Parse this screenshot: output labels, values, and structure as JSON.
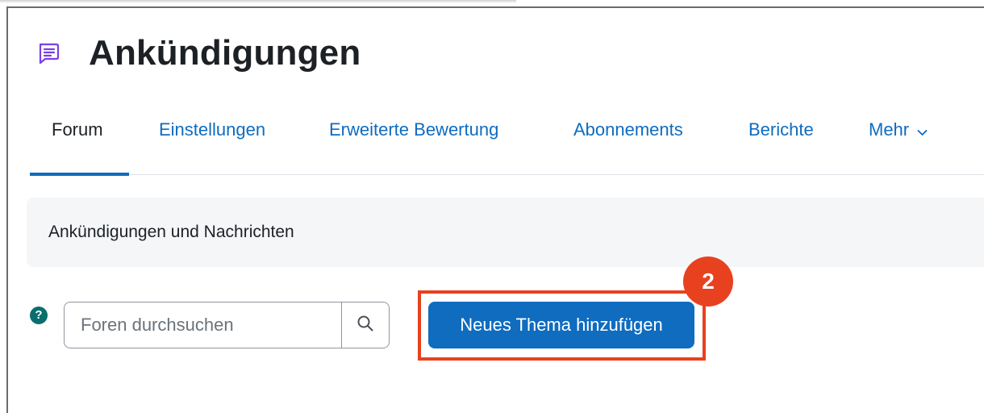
{
  "page": {
    "title": "Ankündigungen",
    "icon": "forum-chat-icon",
    "accent_color": "#0f6cbf",
    "icon_color": "#7b3fe4"
  },
  "tabs": [
    {
      "label": "Forum",
      "active": true
    },
    {
      "label": "Einstellungen",
      "active": false
    },
    {
      "label": "Erweiterte Bewertung",
      "active": false
    },
    {
      "label": "Abonnements",
      "active": false
    },
    {
      "label": "Berichte",
      "active": false
    },
    {
      "label": "Mehr",
      "active": false,
      "icon": "chevron-down-icon"
    }
  ],
  "intro": {
    "text": "Ankündigungen und Nachrichten"
  },
  "help": {
    "icon": "help-icon",
    "symbol": "?"
  },
  "search": {
    "placeholder": "Foren durchsuchen",
    "value": "",
    "button_icon": "search-icon"
  },
  "actions": {
    "add_topic_label": "Neues Thema hinzufügen"
  },
  "annotation": {
    "step_number": "2",
    "color": "#e8411f"
  }
}
